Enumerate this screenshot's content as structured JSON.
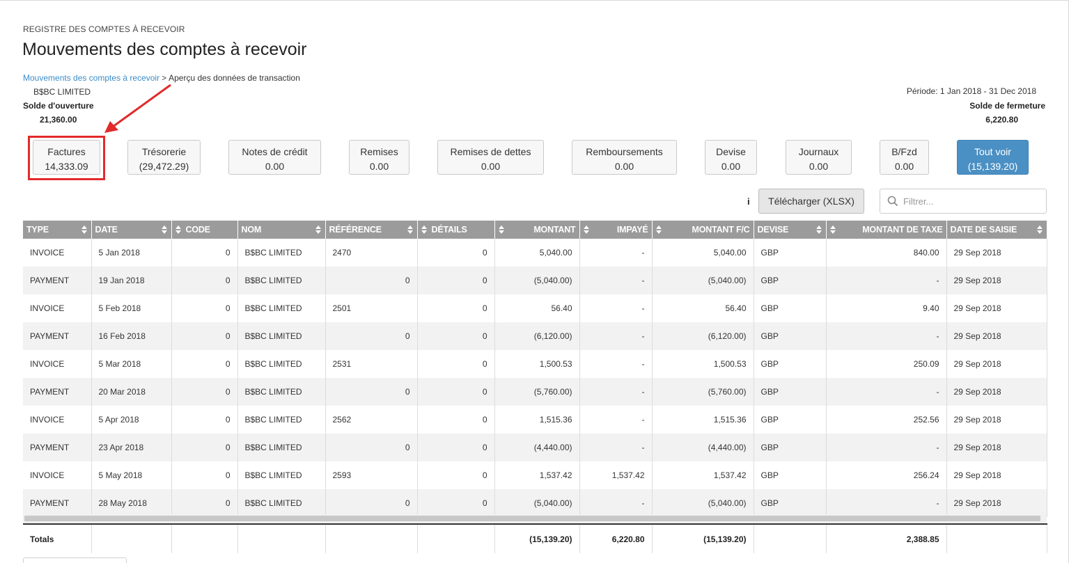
{
  "header": {
    "eyebrow": "REGISTRE DES COMPTES À RECEVOIR",
    "title": "Mouvements des comptes à recevoir"
  },
  "breadcrumb": {
    "link": "Mouvements des comptes à recevoir",
    "separator": ">",
    "current": "Aperçu des données de transaction"
  },
  "summary": {
    "company": "B$BC LIMITED",
    "opening_label": "Solde d'ouverture",
    "opening_value": "21,360.00",
    "period": "Période: 1 Jan 2018 - 31 Dec 2018",
    "closing_label": "Solde de fermeture",
    "closing_value": "6,220.80"
  },
  "categories": [
    {
      "label": "Factures",
      "value": "14,333.09"
    },
    {
      "label": "Trésorerie",
      "value": "(29,472.29)"
    },
    {
      "label": "Notes de crédit",
      "value": "0.00"
    },
    {
      "label": "Remises",
      "value": "0.00"
    },
    {
      "label": "Remises de dettes",
      "value": "0.00"
    },
    {
      "label": "Remboursements",
      "value": "0.00"
    },
    {
      "label": "Devise",
      "value": "0.00"
    },
    {
      "label": "Journaux",
      "value": "0.00"
    },
    {
      "label": "B/Fzd",
      "value": "0.00"
    },
    {
      "label": "Tout voir",
      "value": "(15,139.20)"
    }
  ],
  "toolbar": {
    "info_label": "i",
    "download_label": "Télécharger (XLSX)",
    "filter_placeholder": "Filtrer..."
  },
  "table": {
    "columns": [
      "TYPE",
      "DATE",
      "CODE",
      "NOM",
      "RÉFÉRENCE",
      "DÉTAILS",
      "MONTANT",
      "IMPAYÉ",
      "MONTANT F/C",
      "DEVISE",
      "MONTANT DE TAXE",
      "DATE DE SAISIE"
    ],
    "rows": [
      [
        "INVOICE",
        "5 Jan 2018",
        "0",
        "B$BC LIMITED",
        "2470",
        "0",
        "5,040.00",
        "-",
        "5,040.00",
        "GBP",
        "840.00",
        "29 Sep 2018"
      ],
      [
        "PAYMENT",
        "19 Jan 2018",
        "0",
        "B$BC LIMITED",
        "0",
        "0",
        "(5,040.00)",
        "-",
        "(5,040.00)",
        "GBP",
        "-",
        "29 Sep 2018"
      ],
      [
        "INVOICE",
        "5 Feb 2018",
        "0",
        "B$BC LIMITED",
        "2501",
        "0",
        "56.40",
        "-",
        "56.40",
        "GBP",
        "9.40",
        "29 Sep 2018"
      ],
      [
        "PAYMENT",
        "16 Feb 2018",
        "0",
        "B$BC LIMITED",
        "0",
        "0",
        "(6,120.00)",
        "-",
        "(6,120.00)",
        "GBP",
        "-",
        "29 Sep 2018"
      ],
      [
        "INVOICE",
        "5 Mar 2018",
        "0",
        "B$BC LIMITED",
        "2531",
        "0",
        "1,500.53",
        "-",
        "1,500.53",
        "GBP",
        "250.09",
        "29 Sep 2018"
      ],
      [
        "PAYMENT",
        "20 Mar 2018",
        "0",
        "B$BC LIMITED",
        "0",
        "0",
        "(5,760.00)",
        "-",
        "(5,760.00)",
        "GBP",
        "-",
        "29 Sep 2018"
      ],
      [
        "INVOICE",
        "5 Apr 2018",
        "0",
        "B$BC LIMITED",
        "2562",
        "0",
        "1,515.36",
        "-",
        "1,515.36",
        "GBP",
        "252.56",
        "29 Sep 2018"
      ],
      [
        "PAYMENT",
        "23 Apr 2018",
        "0",
        "B$BC LIMITED",
        "0",
        "0",
        "(4,440.00)",
        "-",
        "(4,440.00)",
        "GBP",
        "-",
        "29 Sep 2018"
      ],
      [
        "INVOICE",
        "5 May 2018",
        "0",
        "B$BC LIMITED",
        "2593",
        "0",
        "1,537.42",
        "1,537.42",
        "1,537.42",
        "GBP",
        "256.24",
        "29 Sep 2018"
      ],
      [
        "PAYMENT",
        "28 May 2018",
        "0",
        "B$BC LIMITED",
        "0",
        "0",
        "(5,040.00)",
        "-",
        "(5,040.00)",
        "GBP",
        "-",
        "29 Sep 2018"
      ]
    ],
    "totals": {
      "label": "Totals",
      "montant": "(15,139.20)",
      "impaye": "6,220.80",
      "montant_fc": "(15,139.20)",
      "taxe": "2,388.85"
    }
  },
  "colors": {
    "accent": "#4b90c4",
    "link": "#3a8bc8",
    "header_bg": "#9b9b9b",
    "annotation": "#e12a2a"
  }
}
